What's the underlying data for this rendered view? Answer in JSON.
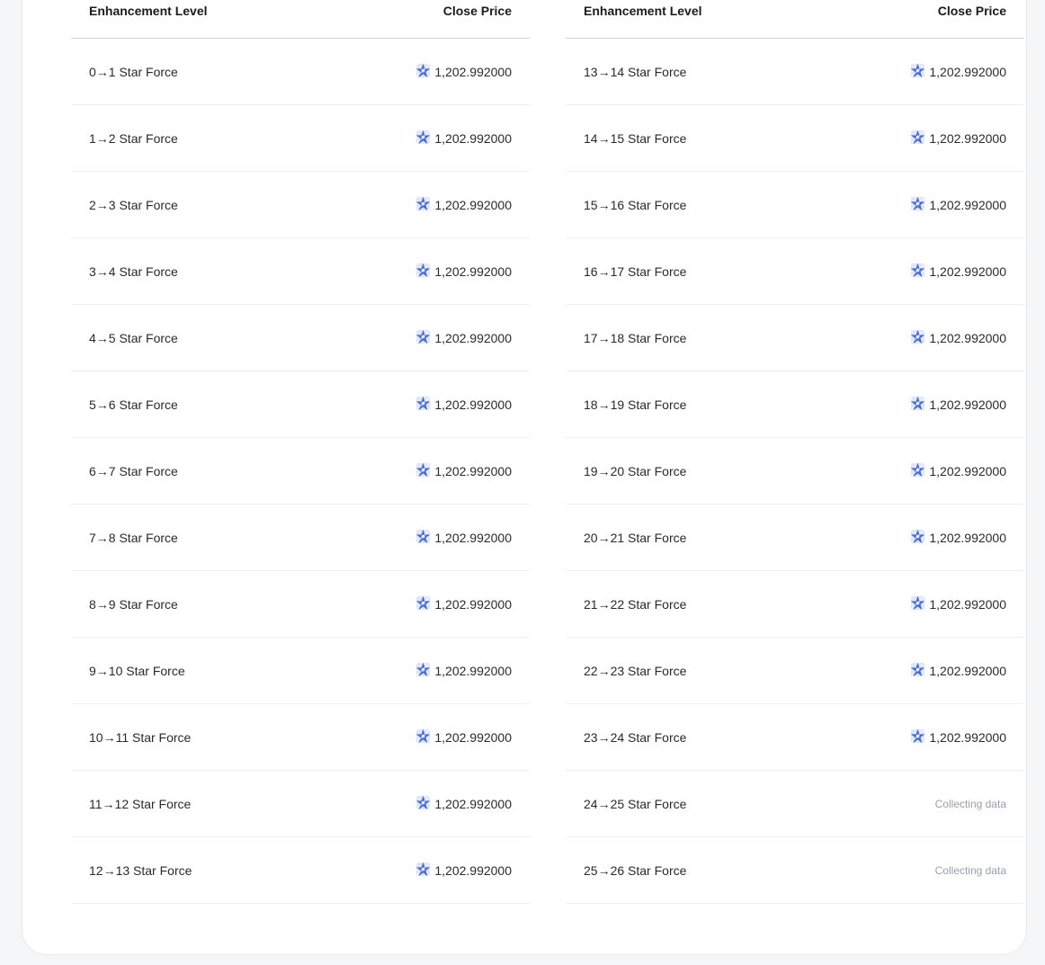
{
  "colors": {
    "page_bg": "#f5f6f8",
    "card_bg": "#ffffff",
    "divider": "#eceef1",
    "muted_text": "#9a9ea5",
    "coin_blue": "#4d6fd8"
  },
  "icons": {
    "price_icon": "blue-star-coin-icon"
  },
  "table_left": {
    "header": {
      "level": "Enhancement Level",
      "price": "Close Price"
    },
    "rows": [
      {
        "level": "0→1 Star Force",
        "price": "1,202.992000",
        "status": null
      },
      {
        "level": "1→2 Star Force",
        "price": "1,202.992000",
        "status": null
      },
      {
        "level": "2→3 Star Force",
        "price": "1,202.992000",
        "status": null
      },
      {
        "level": "3→4 Star Force",
        "price": "1,202.992000",
        "status": null
      },
      {
        "level": "4→5 Star Force",
        "price": "1,202.992000",
        "status": null
      },
      {
        "level": "5→6 Star Force",
        "price": "1,202.992000",
        "status": null
      },
      {
        "level": "6→7 Star Force",
        "price": "1,202.992000",
        "status": null
      },
      {
        "level": "7→8 Star Force",
        "price": "1,202.992000",
        "status": null
      },
      {
        "level": "8→9 Star Force",
        "price": "1,202.992000",
        "status": null
      },
      {
        "level": "9→10 Star Force",
        "price": "1,202.992000",
        "status": null
      },
      {
        "level": "10→11 Star Force",
        "price": "1,202.992000",
        "status": null
      },
      {
        "level": "11→12 Star Force",
        "price": "1,202.992000",
        "status": null
      },
      {
        "level": "12→13 Star Force",
        "price": "1,202.992000",
        "status": null
      }
    ]
  },
  "table_right": {
    "header": {
      "level": "Enhancement Level",
      "price": "Close Price"
    },
    "rows": [
      {
        "level": "13→14 Star Force",
        "price": "1,202.992000",
        "status": null
      },
      {
        "level": "14→15 Star Force",
        "price": "1,202.992000",
        "status": null
      },
      {
        "level": "15→16 Star Force",
        "price": "1,202.992000",
        "status": null
      },
      {
        "level": "16→17 Star Force",
        "price": "1,202.992000",
        "status": null
      },
      {
        "level": "17→18 Star Force",
        "price": "1,202.992000",
        "status": null
      },
      {
        "level": "18→19 Star Force",
        "price": "1,202.992000",
        "status": null
      },
      {
        "level": "19→20 Star Force",
        "price": "1,202.992000",
        "status": null
      },
      {
        "level": "20→21 Star Force",
        "price": "1,202.992000",
        "status": null
      },
      {
        "level": "21→22 Star Force",
        "price": "1,202.992000",
        "status": null
      },
      {
        "level": "22→23 Star Force",
        "price": "1,202.992000",
        "status": null
      },
      {
        "level": "23→24 Star Force",
        "price": "1,202.992000",
        "status": null
      },
      {
        "level": "24→25 Star Force",
        "price": null,
        "status": "Collecting data"
      },
      {
        "level": "25→26 Star Force",
        "price": null,
        "status": "Collecting data"
      }
    ]
  }
}
